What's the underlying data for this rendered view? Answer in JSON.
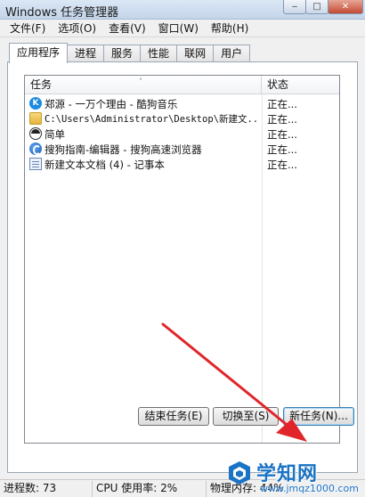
{
  "window": {
    "title": "Windows 任务管理器",
    "controls": {
      "minimize": "‒",
      "maximize": "□",
      "close": "✕"
    }
  },
  "menu": [
    "文件(F)",
    "选项(O)",
    "查看(V)",
    "窗口(W)",
    "帮助(H)"
  ],
  "tabs": [
    {
      "label": "应用程序",
      "active": true
    },
    {
      "label": "进程",
      "active": false
    },
    {
      "label": "服务",
      "active": false
    },
    {
      "label": "性能",
      "active": false
    },
    {
      "label": "联网",
      "active": false
    },
    {
      "label": "用户",
      "active": false
    }
  ],
  "task_list": {
    "columns": {
      "task": "任务",
      "status": "状态"
    },
    "sort_indicator": "˄",
    "rows": [
      {
        "icon": "kugou-music-icon",
        "icon_text": "K",
        "name": "郑源 - 一万个理由 - 酷狗音乐",
        "status": "正在..."
      },
      {
        "icon": "folder-icon",
        "icon_text": "",
        "name": "C:\\Users\\Administrator\\Desktop\\新建文...",
        "status": "正在..."
      },
      {
        "icon": "jianshu-avatar-icon",
        "icon_text": "",
        "name": "简单",
        "status": "正在..."
      },
      {
        "icon": "sogou-browser-icon",
        "icon_text": "",
        "name": "搜狗指南-编辑器 - 搜狗高速浏览器",
        "status": "正在..."
      },
      {
        "icon": "notepad-icon",
        "icon_text": "",
        "name": "新建文本文档 (4) - 记事本",
        "status": "正在..."
      }
    ]
  },
  "buttons": {
    "end_task": "结束任务(E)",
    "switch_to": "切换至(S)",
    "new_task": "新任务(N)..."
  },
  "statusbar": {
    "processes": "进程数: 73",
    "cpu": "CPU 使用率: 2%",
    "memory": "物理内存: 44%"
  },
  "watermark": {
    "name": "学知网",
    "url": "www.jmqz1000.com"
  },
  "colors": {
    "annotation_arrow": "#e0262b",
    "watermark_blue": "#1b73c4"
  }
}
